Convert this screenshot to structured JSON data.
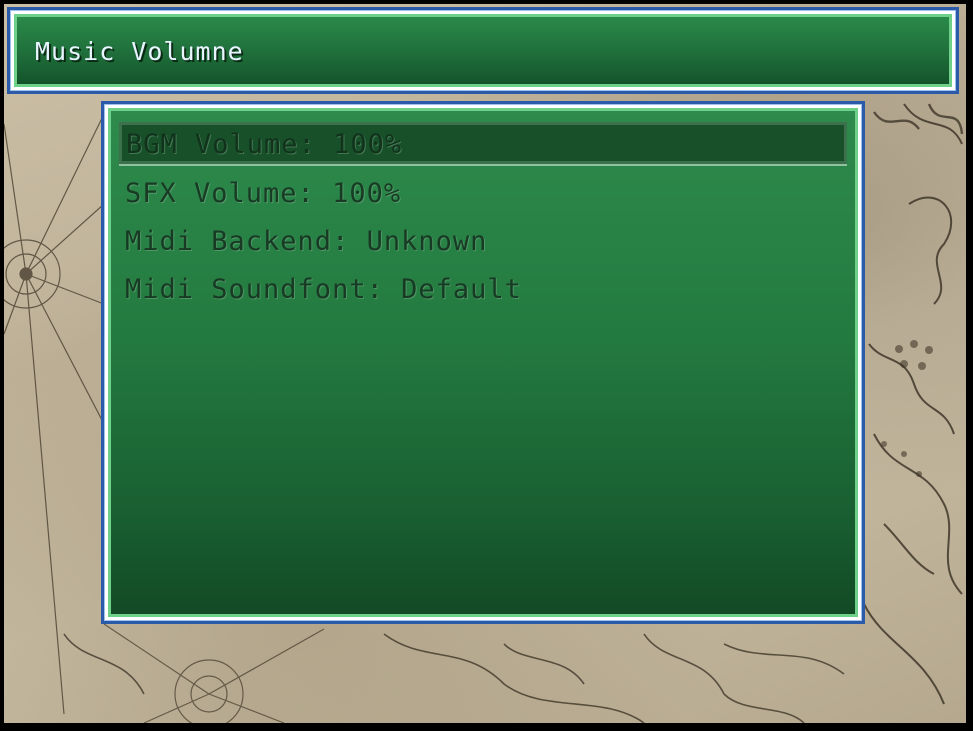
{
  "title": "Music Volumne",
  "menu": {
    "items": [
      {
        "label": "BGM Volume: 100%",
        "selected": true
      },
      {
        "label": "SFX Volume: 100%",
        "selected": false
      },
      {
        "label": "Midi Backend: Unknown",
        "selected": false
      },
      {
        "label": "Midi Soundfont: Default",
        "selected": false
      }
    ]
  },
  "colors": {
    "window_border": "#2a5aa8",
    "window_inner_border": "#6fd08a",
    "window_fill_top": "#2e8b4c",
    "window_fill_bottom": "#124a25",
    "title_text": "#e8f4ff",
    "menu_text": "#173321",
    "background_map": "#c4b89f"
  }
}
